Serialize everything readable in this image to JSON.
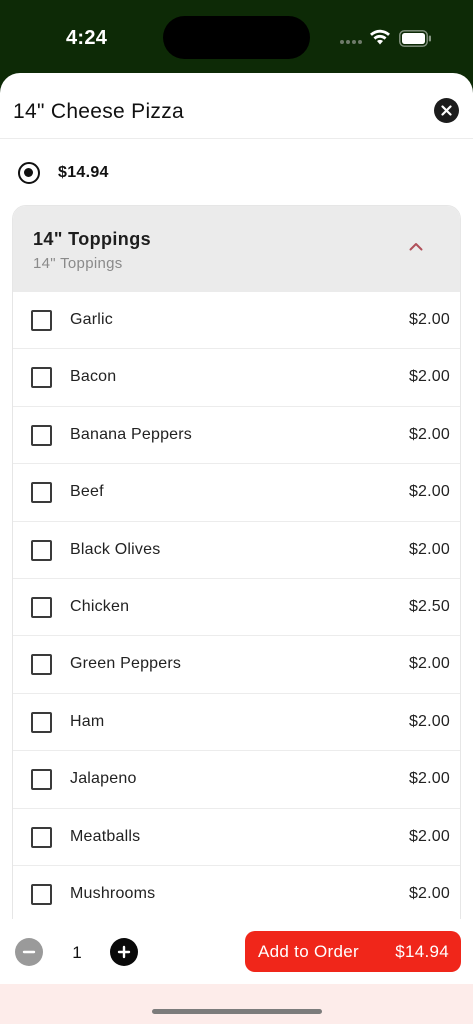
{
  "status_bar": {
    "time": "4:24"
  },
  "sheet": {
    "title": "14\" Cheese Pizza"
  },
  "size_option": {
    "price": "$14.94",
    "selected": true
  },
  "toppings_group": {
    "title": "14\" Toppings",
    "subtitle": "14\" Toppings",
    "expanded": true,
    "items": [
      {
        "name": "Garlic",
        "price": "$2.00"
      },
      {
        "name": "Bacon",
        "price": "$2.00"
      },
      {
        "name": "Banana Peppers",
        "price": "$2.00"
      },
      {
        "name": "Beef",
        "price": "$2.00"
      },
      {
        "name": "Black Olives",
        "price": "$2.00"
      },
      {
        "name": "Chicken",
        "price": "$2.50"
      },
      {
        "name": "Green Peppers",
        "price": "$2.00"
      },
      {
        "name": "Ham",
        "price": "$2.00"
      },
      {
        "name": "Jalapeno",
        "price": "$2.00"
      },
      {
        "name": "Meatballs",
        "price": "$2.00"
      },
      {
        "name": "Mushrooms",
        "price": "$2.00"
      }
    ]
  },
  "footer": {
    "quantity": "1",
    "add_label": "Add to Order",
    "total": "$14.94"
  },
  "colors": {
    "status_bar_bg": "#0d2a06",
    "accent": "#f0261a",
    "chevron": "#b0505a",
    "home_area_bg": "#fdecea"
  },
  "icons": {
    "close": "close-icon",
    "chevron": "chevron-up-icon",
    "minus": "minus-icon",
    "plus": "plus-icon",
    "wifi": "wifi-icon",
    "battery": "battery-icon"
  }
}
